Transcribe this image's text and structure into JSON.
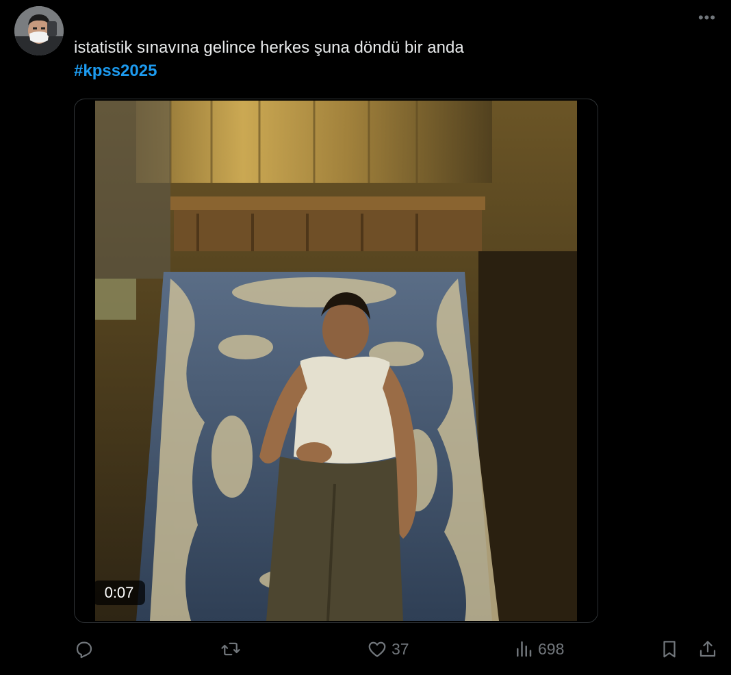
{
  "tweet": {
    "text": "istatistik sınavına gelince herkes şuna döndü bir anda",
    "hashtag": "#kpss2025",
    "more_label": "•••"
  },
  "media": {
    "timecode": "0:07"
  },
  "actions": {
    "reply": {
      "icon": "reply-icon",
      "count": ""
    },
    "retweet": {
      "icon": "retweet-icon",
      "count": ""
    },
    "like": {
      "icon": "heart-icon",
      "count": "37"
    },
    "views": {
      "icon": "views-chart-icon",
      "count": "698"
    },
    "bookmark": {
      "icon": "bookmark-icon"
    },
    "share": {
      "icon": "share-icon"
    }
  },
  "colors": {
    "background": "#000000",
    "text": "#e7e9ea",
    "hashtag": "#1d9bf0",
    "muted": "#71767b",
    "border": "#2f3336"
  }
}
